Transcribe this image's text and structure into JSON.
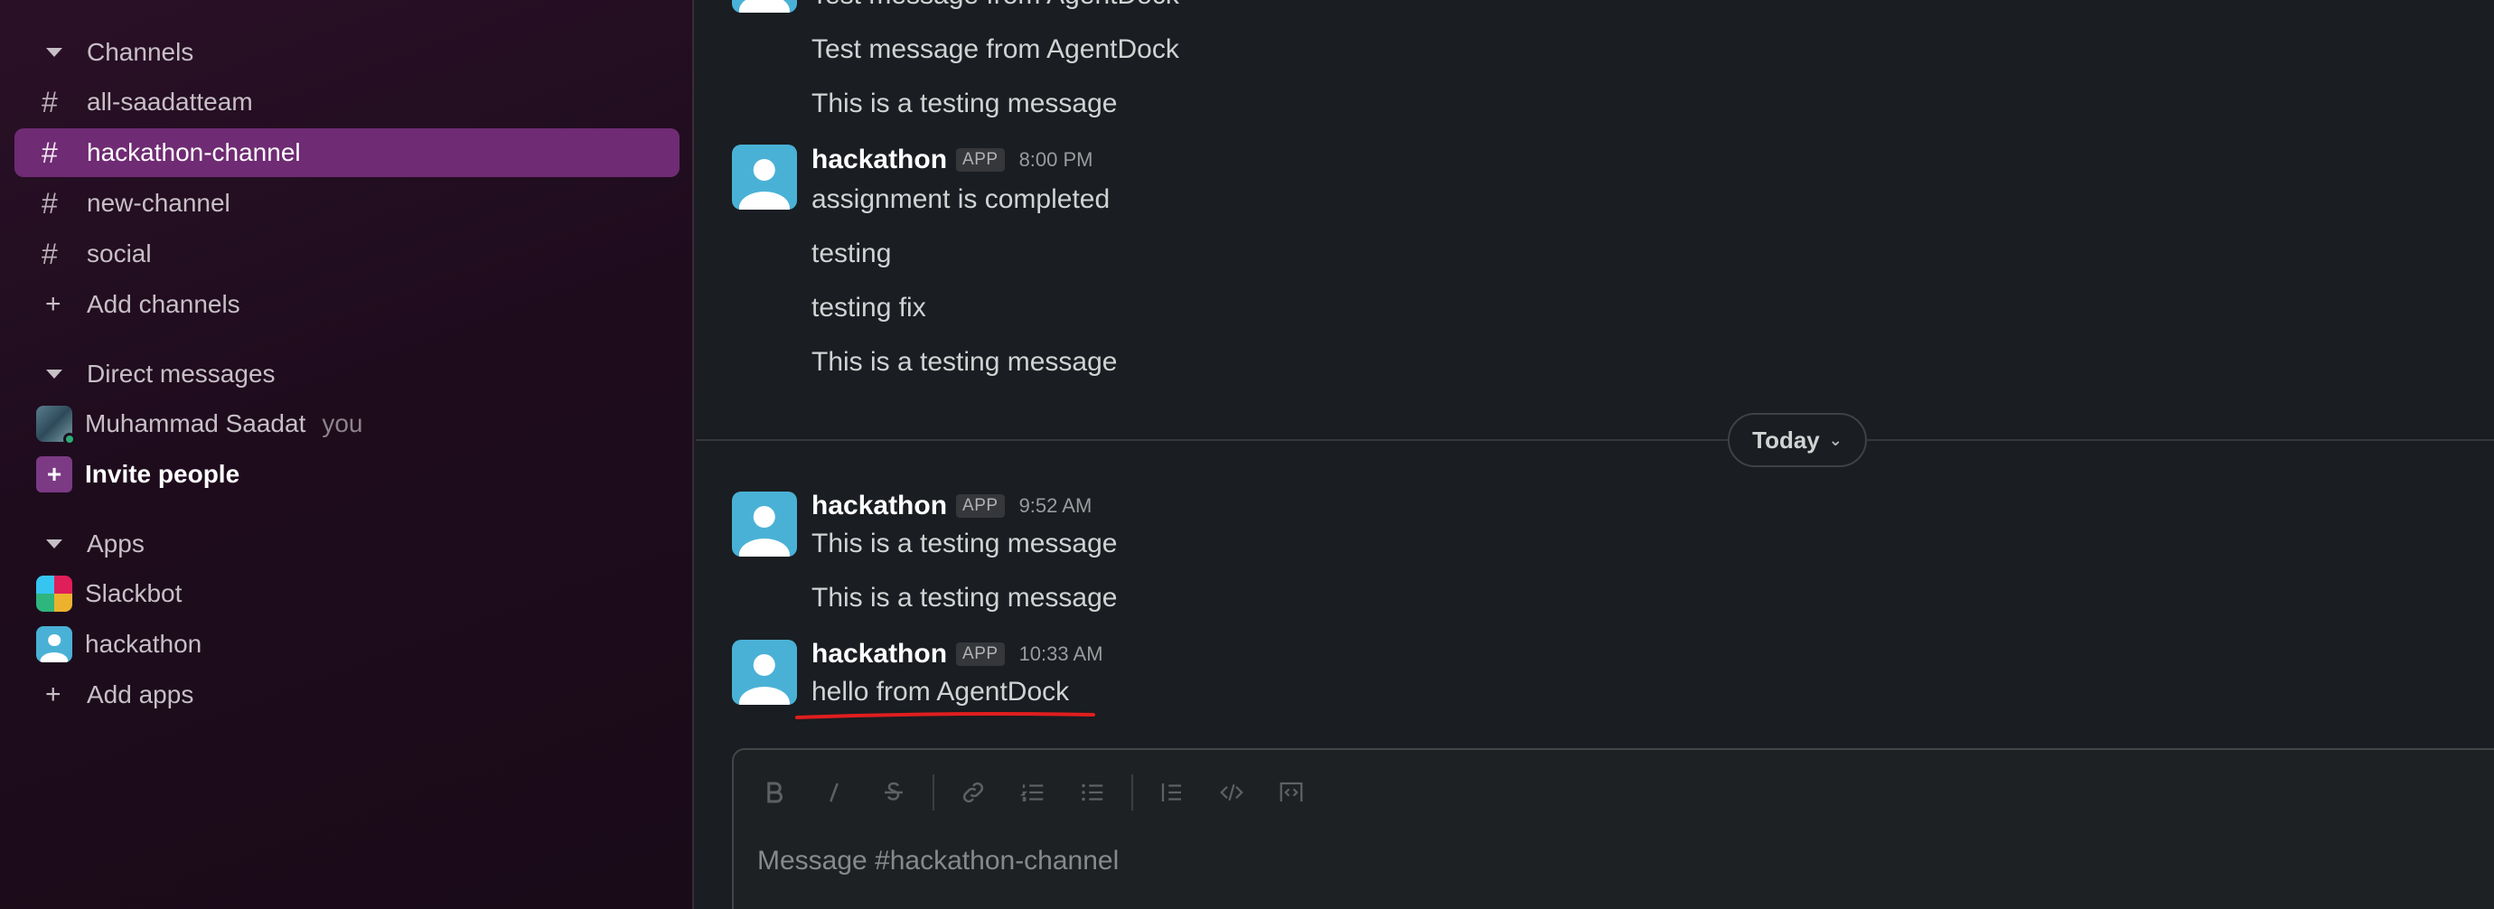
{
  "sidebar": {
    "channels_header": "Channels",
    "channels": [
      {
        "name": "all-saadatteam",
        "active": false
      },
      {
        "name": "hackathon-channel",
        "active": true
      },
      {
        "name": "new-channel",
        "active": false
      },
      {
        "name": "social",
        "active": false
      }
    ],
    "add_channels": "Add channels",
    "dm_header": "Direct messages",
    "dm_user": "Muhammad Saadat",
    "dm_you": "you",
    "invite": "Invite people",
    "apps_header": "Apps",
    "apps": [
      "Slackbot",
      "hackathon"
    ],
    "add_apps": "Add apps",
    "colors": {
      "active_bg": "#6f2b73",
      "presence": "#2bac76"
    }
  },
  "messages": {
    "partial_top": "Test message from AgentDock",
    "earlier": [
      "Test message from AgentDock",
      "This is a testing message"
    ],
    "group1": {
      "sender": "hackathon",
      "badge": "APP",
      "time": "8:00 PM",
      "lines": [
        "assignment is completed",
        "testing",
        "testing fix",
        "This is a testing message"
      ]
    },
    "divider": "Today",
    "group2": {
      "sender": "hackathon",
      "badge": "APP",
      "time": "9:52 AM",
      "lines": [
        "This is a testing message",
        "This is a testing message"
      ]
    },
    "group3": {
      "sender": "hackathon",
      "badge": "APP",
      "time": "10:33 AM",
      "lines": [
        "hello from AgentDock"
      ]
    },
    "highlight_color": "#e01e1e"
  },
  "composer": {
    "placeholder": "Message #hackathon-channel",
    "toolbar_icons": [
      "bold-icon",
      "italic-icon",
      "strikethrough-icon",
      "link-icon",
      "ordered-list-icon",
      "bulleted-list-icon",
      "blockquote-icon",
      "code-icon",
      "code-block-icon"
    ]
  }
}
